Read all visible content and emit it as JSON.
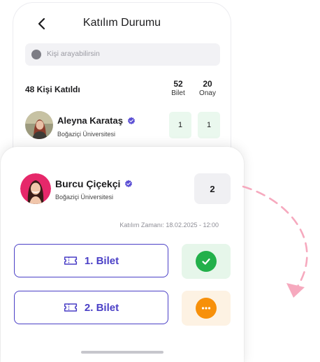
{
  "header": {
    "title": "Katılım Durumu"
  },
  "search": {
    "placeholder": "Kişi arayabilirsin"
  },
  "summary": {
    "attendees_label": "48 Kişi Katıldı",
    "tickets": {
      "value": "52",
      "label": "Bilet"
    },
    "approved": {
      "value": "20",
      "label": "Onay"
    }
  },
  "list": {
    "items": [
      {
        "name": "Aleyna Karataş",
        "university": "Boğaziçi Üniversitesi",
        "tickets": "1",
        "approved": "1"
      }
    ]
  },
  "detail": {
    "name": "Burcu Çiçekçi",
    "university": "Boğaziçi Üniversitesi",
    "ticket_count": "2",
    "join_time_label": "Katılım Zamanı:",
    "join_time_value": "18.02.2025 - 12:00",
    "tickets": [
      {
        "label": "1. Bilet",
        "status": "approved",
        "status_icon": "check-icon"
      },
      {
        "label": "2. Bilet",
        "status": "pending",
        "status_icon": "more-dots-icon"
      }
    ]
  },
  "colors": {
    "accent": "#4a3fc6",
    "verified": "#5b4fd4",
    "approved": "#22b04a",
    "approved_bg": "#e6f6ea",
    "pending": "#f7900a",
    "pending_bg": "#fdf2e3",
    "arrow": "#f6a9be"
  }
}
